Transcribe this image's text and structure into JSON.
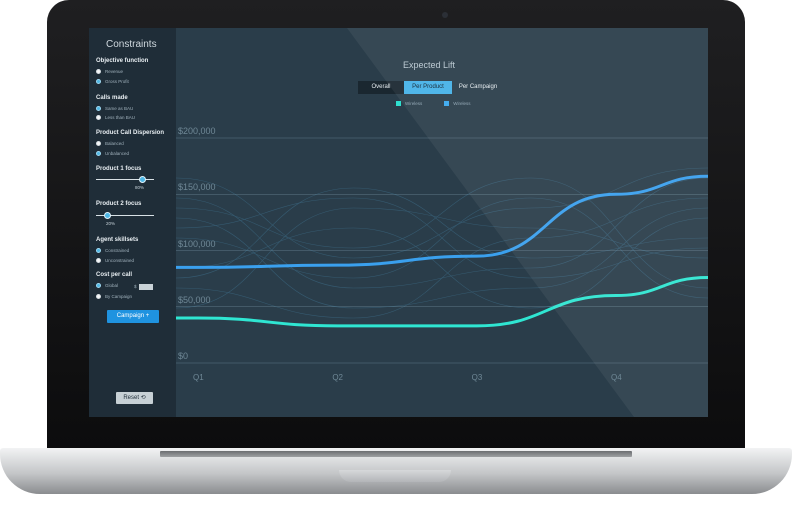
{
  "sidebar": {
    "title": "Constraints",
    "objective": {
      "label": "Objective function",
      "options": [
        "Revenue",
        "Gross Profit"
      ],
      "selected": 1
    },
    "calls": {
      "label": "Calls made",
      "options": [
        "Same as BAU",
        "Less than BAU"
      ],
      "selected": 0
    },
    "dispersion": {
      "label": "Product Call Dispersion",
      "options": [
        "Balanced",
        "Unbalanced"
      ],
      "selected": 1
    },
    "product1": {
      "label": "Product 1 focus",
      "value_text": "80%",
      "value": 0.8
    },
    "product2": {
      "label": "Product 2 focus",
      "value_text": "20%",
      "value": 0.2
    },
    "skillsets": {
      "label": "Agent skillsets",
      "options": [
        "Constrained",
        "Unconstrained"
      ],
      "selected": 0
    },
    "cost": {
      "label": "Cost per call",
      "options": [
        "Global",
        "By Campaign"
      ],
      "selected": 0,
      "currency": "$"
    },
    "campaign_button": "Campaign +",
    "reset_button": "Reset ⟲"
  },
  "main": {
    "title": "Expected Lift",
    "tabs": [
      "Overall",
      "Per Product",
      "Per Campaign"
    ],
    "active_tab": 1,
    "legend": [
      {
        "name": "Wireless",
        "color": "#2fe0d0"
      },
      {
        "name": "Wireless",
        "color": "#3aa8ee"
      }
    ]
  },
  "chart_data": {
    "type": "line",
    "title": "Expected Lift",
    "x": [
      "Q1",
      "Q2",
      "Q3",
      "Q4"
    ],
    "ylim": [
      0,
      200000
    ],
    "yticks": [
      "$0",
      "$50,000",
      "$100,000",
      "$150,000",
      "$200,000"
    ],
    "grid": true,
    "series": [
      {
        "name": "Wireless",
        "color": "#3aa0ee",
        "values": [
          85000,
          87000,
          95000,
          150000
        ]
      },
      {
        "name": "Wireless",
        "color": "#2fe6d2",
        "values": [
          40000,
          33000,
          33000,
          60000
        ]
      }
    ]
  }
}
